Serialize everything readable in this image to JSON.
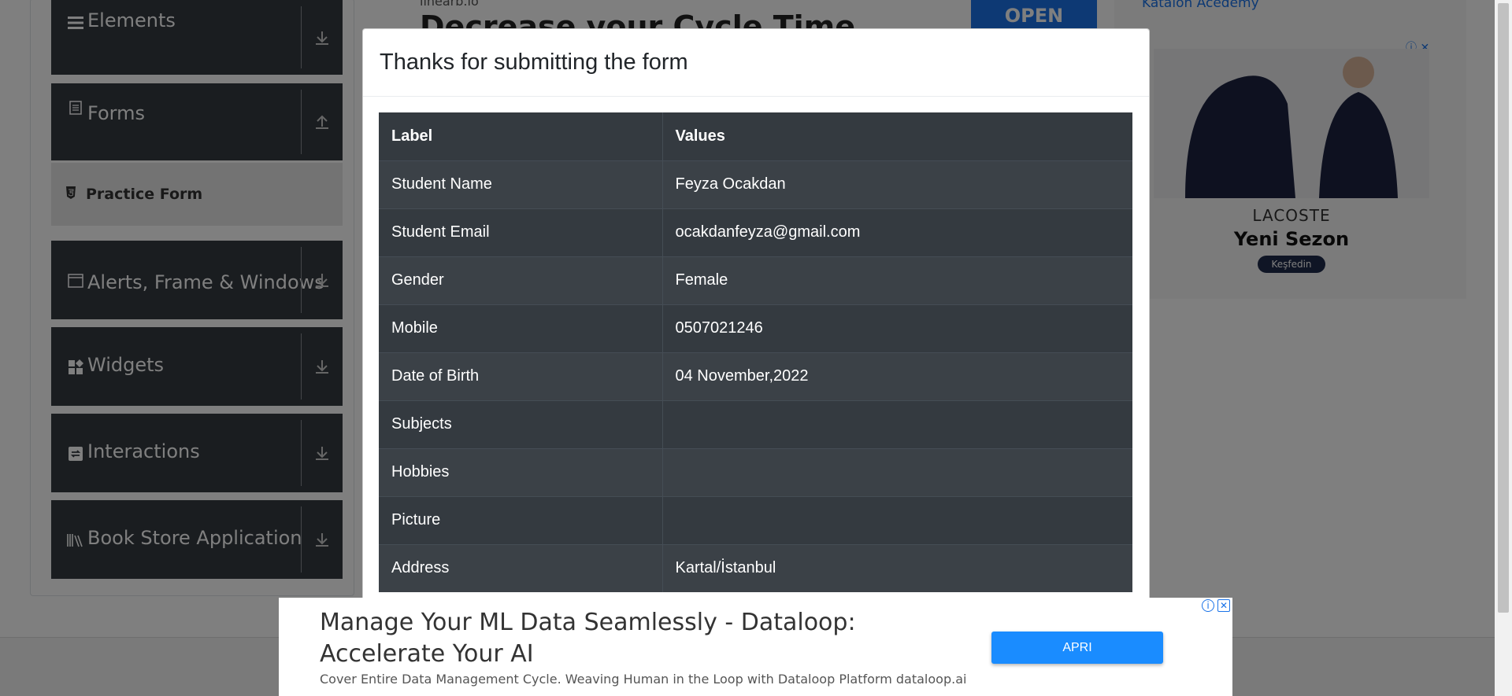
{
  "sidebar": {
    "groups": [
      {
        "label": "Elements",
        "icon": "hamburger-icon",
        "arrow": "download-arrow-icon"
      },
      {
        "label": "Forms",
        "icon": "document-icon",
        "arrow": "upload-arrow-icon"
      },
      {
        "label": "Alerts, Frame & Windows",
        "icon": "window-icon",
        "arrow": "download-arrow-icon"
      },
      {
        "label": "Widgets",
        "icon": "widgets-icon",
        "arrow": "download-arrow-icon"
      },
      {
        "label": "Interactions",
        "icon": "interactions-icon",
        "arrow": "download-arrow-icon"
      },
      {
        "label": "Book Store Application",
        "icon": "books-icon",
        "arrow": "download-arrow-icon"
      }
    ],
    "active_item": {
      "label": "Practice Form",
      "icon": "html5-icon"
    }
  },
  "top_ad": {
    "source": "linearb.io",
    "headline": "Decrease your Cycle Time",
    "button": "OPEN"
  },
  "right_ad": {
    "broken_image_alt": "Katalon Acedemy",
    "brand": "LACOSTE",
    "tagline": "Yeni Sezon",
    "cta": "Keşfedin"
  },
  "modal": {
    "title": "Thanks for submitting the form",
    "table": {
      "headers": [
        "Label",
        "Values"
      ],
      "rows": [
        {
          "label": "Student Name",
          "value": "Feyza Ocakdan"
        },
        {
          "label": "Student Email",
          "value": "ocakdanfeyza@gmail.com"
        },
        {
          "label": "Gender",
          "value": "Female"
        },
        {
          "label": "Mobile",
          "value": "0507021246"
        },
        {
          "label": "Date of Birth",
          "value": "04 November,2022"
        },
        {
          "label": "Subjects",
          "value": ""
        },
        {
          "label": "Hobbies",
          "value": ""
        },
        {
          "label": "Picture",
          "value": ""
        },
        {
          "label": "Address",
          "value": "Kartal/İstanbul"
        }
      ]
    }
  },
  "bottom_ad": {
    "headline": "Manage Your ML Data Seamlessly - Dataloop: Accelerate Your AI",
    "description": "Cover Entire Data Management Cycle. Weaving Human in the Loop with Dataloop Platform dataloop.ai",
    "button": "APRI"
  },
  "colors": {
    "table_bg": "#343a40",
    "overlay": "rgba(0,0,0,0.5)",
    "ad_button": "#1a8cff"
  }
}
